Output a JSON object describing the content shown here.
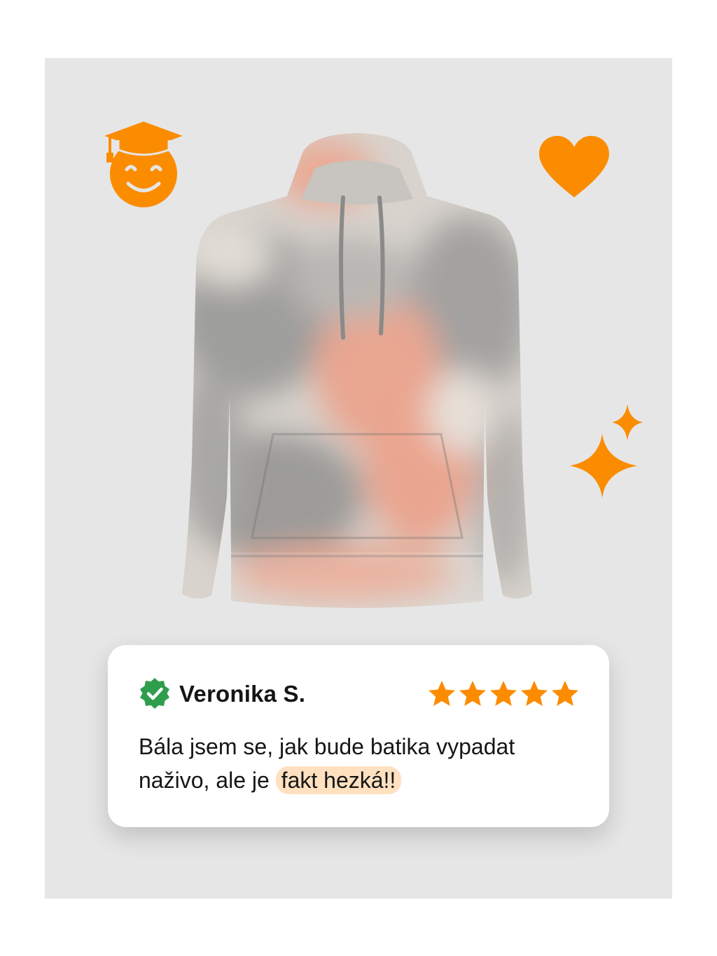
{
  "review": {
    "name": "Veronika S.",
    "rating": 5,
    "rating_max": 5,
    "line1": "Bála jsem se, jak bude batika vypadat",
    "line2_prefix": "naživo, ale je",
    "highlight": "fakt hezká!!"
  },
  "icons": [
    "graduate-smiley-icon",
    "heart-icon",
    "sparkles-icon",
    "verified-badge-icon",
    "star-icon"
  ],
  "colors": {
    "accent": "#fb8c00",
    "verified": "#2e9e4d",
    "highlight": "#ffe1c0",
    "background": "#e6e6e6",
    "card": "#ffffff"
  }
}
